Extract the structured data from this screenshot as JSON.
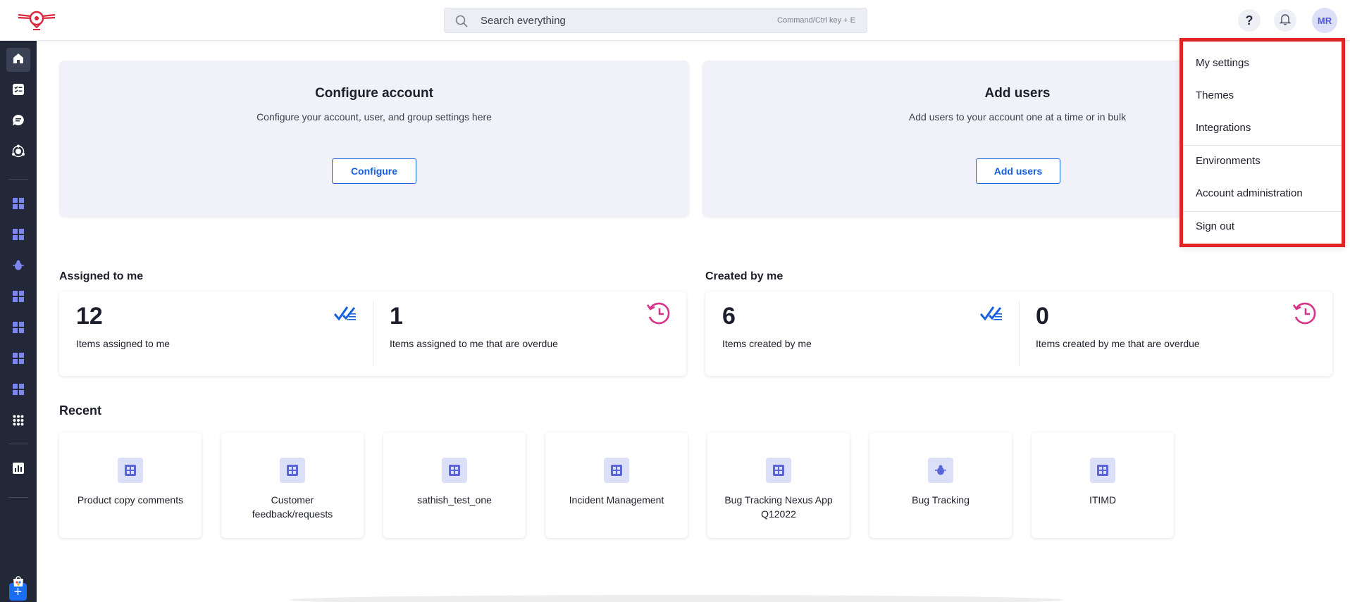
{
  "header": {
    "search_placeholder": "Search everything",
    "search_hint": "Command/Ctrl key + E",
    "help_label": "?",
    "avatar_initials": "MR"
  },
  "promos": [
    {
      "title": "Configure account",
      "description": "Configure your account, user, and group settings here",
      "button": "Configure"
    },
    {
      "title": "Add users",
      "description": "Add users to your account one at a time or in bulk",
      "button": "Add users"
    }
  ],
  "assigned": {
    "title": "Assigned to me",
    "stats": [
      {
        "value": "12",
        "label": "Items assigned to me",
        "icon": "checklist-icon"
      },
      {
        "value": "1",
        "label": "Items assigned to me that are overdue",
        "icon": "clock-history-icon"
      }
    ]
  },
  "created": {
    "title": "Created by me",
    "stats": [
      {
        "value": "6",
        "label": "Items created by me",
        "icon": "checklist-icon"
      },
      {
        "value": "0",
        "label": "Items created by me that are overdue",
        "icon": "clock-history-icon"
      }
    ]
  },
  "recent": {
    "title": "Recent",
    "items": [
      {
        "label": "Product copy comments",
        "icon": "grid-icon"
      },
      {
        "label": "Customer feedback/requests",
        "icon": "grid-icon"
      },
      {
        "label": "sathish_test_one",
        "icon": "grid-icon"
      },
      {
        "label": "Incident Management",
        "icon": "grid-icon"
      },
      {
        "label": "Bug Tracking Nexus App Q12022",
        "icon": "grid-icon"
      },
      {
        "label": "Bug Tracking",
        "icon": "bug-icon"
      },
      {
        "label": "ITIMD",
        "icon": "grid-icon"
      }
    ]
  },
  "menu": {
    "items": [
      "My settings",
      "Themes",
      "Integrations",
      "Environments",
      "Account administration",
      "Sign out"
    ]
  },
  "colors": {
    "accent": "#1660e0",
    "overdue": "#d6338a",
    "sidebar": "#232838",
    "highlight": "#e02424"
  }
}
